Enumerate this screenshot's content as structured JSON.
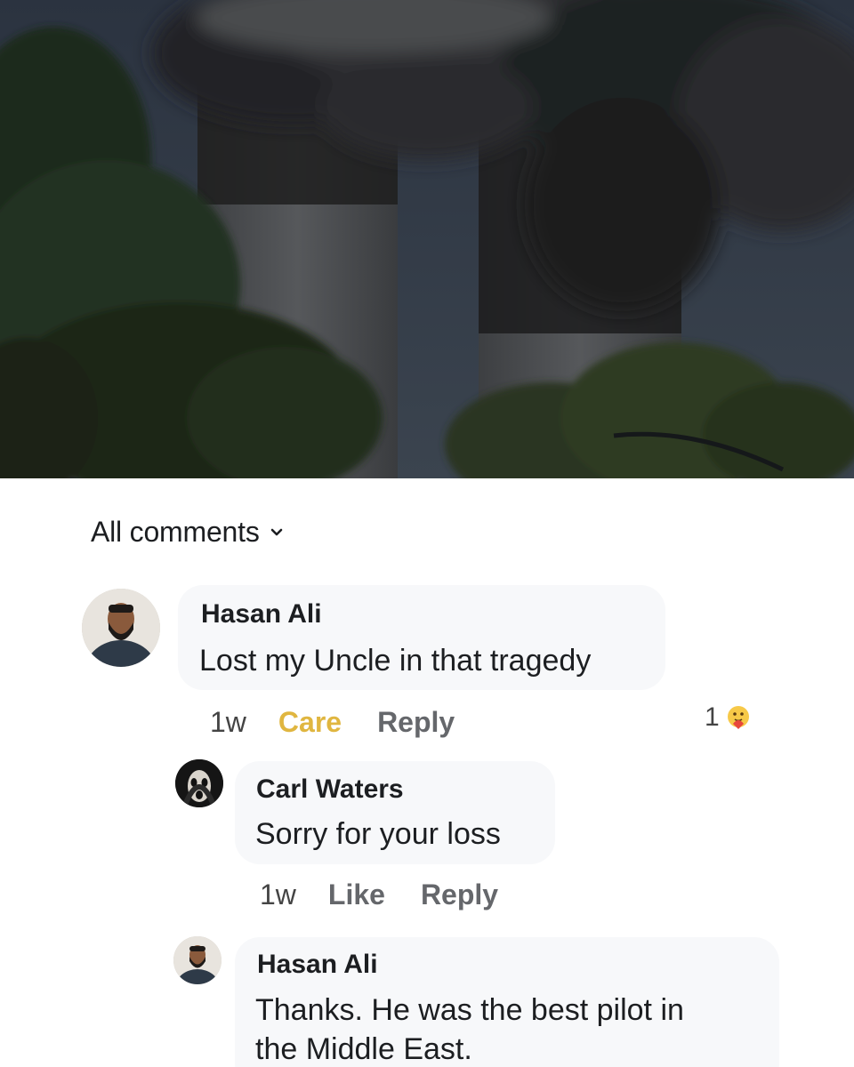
{
  "comments_header": {
    "filter_label": "All comments"
  },
  "colors": {
    "care": "#e0b640",
    "action": "#65676b",
    "bubble": "#f7f8fa"
  },
  "comments": [
    {
      "author": "Hasan Ali",
      "text": "Lost my Uncle in that tragedy",
      "time": "1w",
      "actions": [
        "Care",
        "Reply"
      ],
      "reaction_count": "1",
      "reaction_icon": "care-emoji-icon"
    },
    {
      "author": "Carl Waters",
      "text": "Sorry for your loss",
      "time": "1w",
      "actions": [
        "Like",
        "Reply"
      ]
    },
    {
      "author": "Hasan Ali",
      "text_line1": "Thanks. He was the best pilot in",
      "text_line2": "the Middle East."
    }
  ]
}
